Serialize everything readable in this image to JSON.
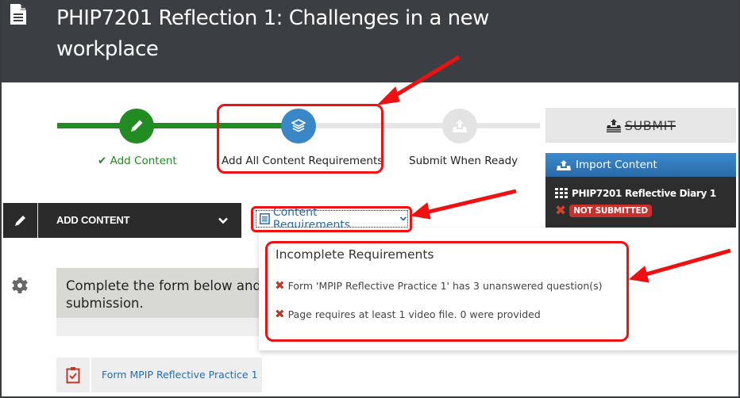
{
  "header": {
    "title": "PHIP7201 Reflection 1: Challenges in a new workplace",
    "icon": "document-icon"
  },
  "steps": [
    {
      "label": "Add Content",
      "status": "complete",
      "icon": "pencil-icon",
      "check": "✔"
    },
    {
      "label": "Add All Content Requirements",
      "status": "current",
      "icon": "layers-icon"
    },
    {
      "label": "Submit When Ready",
      "status": "pending",
      "icon": "upload-icon"
    }
  ],
  "submit": {
    "label": "SUBMIT",
    "disabled": true,
    "icon": "upload-icon"
  },
  "import_panel": {
    "button_label": "Import Content",
    "item_title": "PHIP7201 Reflective Diary 1",
    "item_status": "NOT SUBMITTED"
  },
  "add_content": {
    "label": "ADD CONTENT"
  },
  "content_requirements": {
    "toggle_label": "Content Requirements",
    "panel_title": "Incomplete Requirements",
    "items": [
      "Form 'MPIP Reflective Practice 1' has 3 unanswered question(s)",
      "Page requires at least 1 video file. 0 were provided"
    ]
  },
  "instructions": {
    "text_line1": "Complete the form below and",
    "text_line2": "submission."
  },
  "form_link": {
    "label": "Form MPIP Reflective Practice 1"
  },
  "colors": {
    "header_bg": "#3b3e43",
    "complete_green": "#228b22",
    "current_blue": "#3a87c8",
    "link_blue": "#2a6aa8",
    "error_red": "#c9302c",
    "annotation_red": "#ee1111"
  }
}
